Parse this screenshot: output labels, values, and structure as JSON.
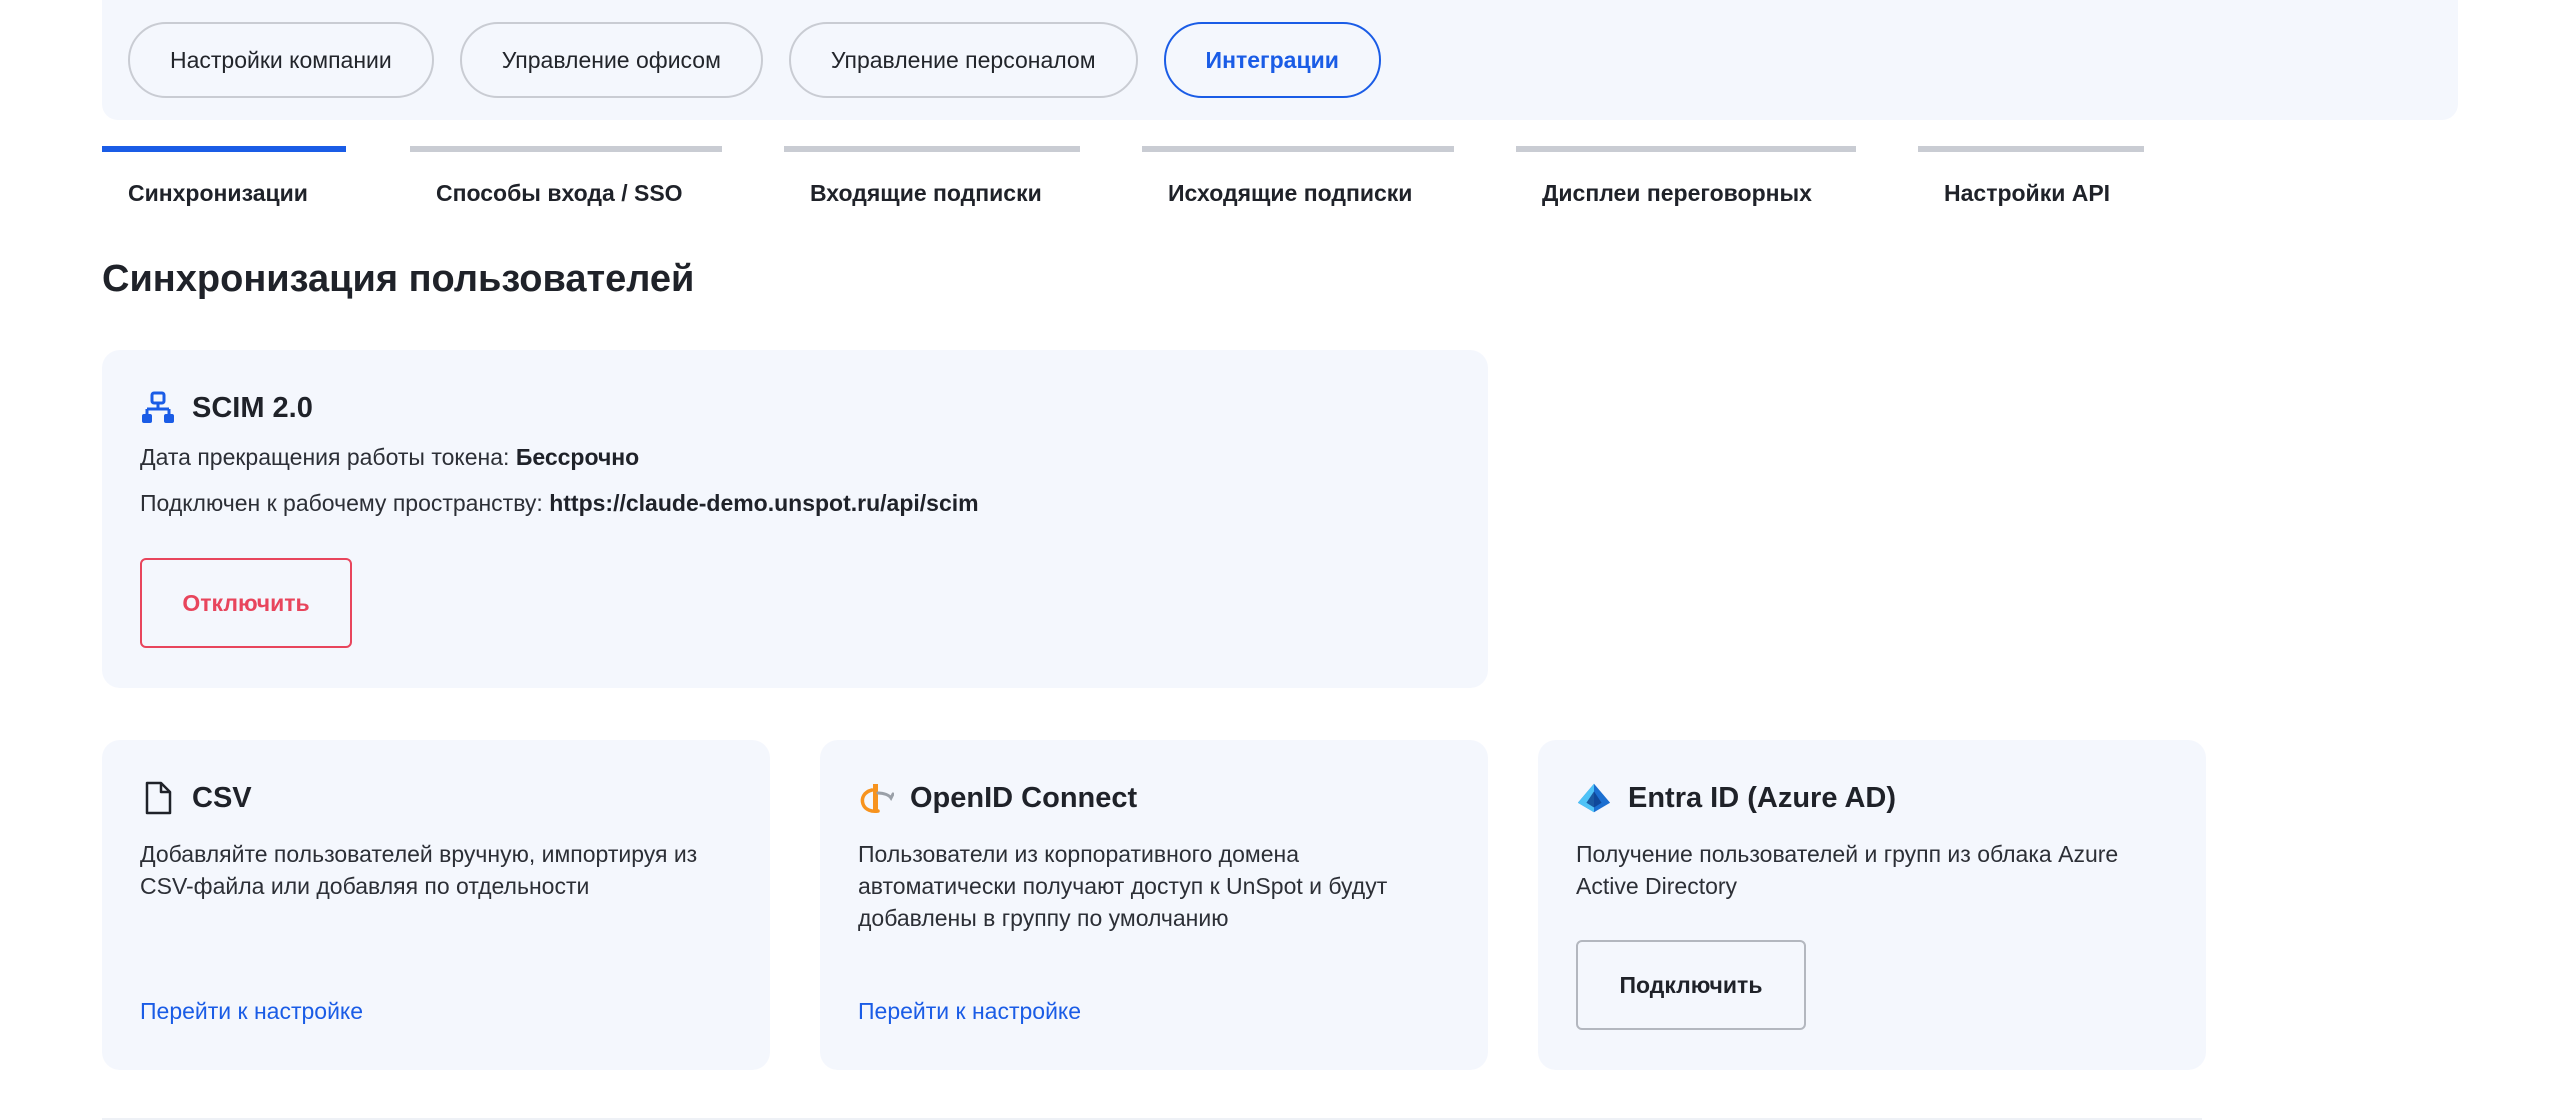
{
  "top_nav": {
    "items": [
      {
        "label": "Настройки компании"
      },
      {
        "label": "Управление офисом"
      },
      {
        "label": "Управление персоналом"
      },
      {
        "label": "Интеграции"
      }
    ],
    "active_index": 3
  },
  "sub_tabs": {
    "items": [
      {
        "label": "Синхронизации"
      },
      {
        "label": "Способы входа / SSO"
      },
      {
        "label": "Входящие подписки"
      },
      {
        "label": "Исходящие подписки"
      },
      {
        "label": "Дисплеи переговорных"
      },
      {
        "label": "Настройки API"
      }
    ],
    "active_index": 0
  },
  "section_title": "Синхронизация пользователей",
  "scim": {
    "title": "SCIM 2.0",
    "token_label": "Дата прекращения работы токена:",
    "token_value": "Бессрочно",
    "workspace_label": "Подключен к рабочему пространству:",
    "workspace_value": "https://claude-demo.unspot.ru/api/scim",
    "disconnect_label": "Отключить",
    "icon": "network-icon",
    "accent": "#1a5ce6"
  },
  "csv": {
    "title": "CSV",
    "description": "Добавляйте пользователей вручную, импортируя из CSV-файла или добавляя по отдельности",
    "link_label": "Перейти к настройке",
    "icon": "file-icon"
  },
  "openid": {
    "title": "OpenID Connect",
    "description": "Пользователи из корпоративного домена автоматически получают доступ к UnSpot и будут добавлены в группу по умолчанию",
    "link_label": "Перейти к настройке",
    "icon": "openid-icon"
  },
  "entra": {
    "title": "Entra ID (Azure AD)",
    "description": "Получение пользователей и групп из облака Azure Active Directory",
    "connect_label": "Подключить",
    "icon": "azure-icon"
  },
  "colors": {
    "accent": "#1a5ce6",
    "danger": "#e8455c",
    "card_bg": "#f4f7fd",
    "openid_orange": "#f7931e"
  }
}
